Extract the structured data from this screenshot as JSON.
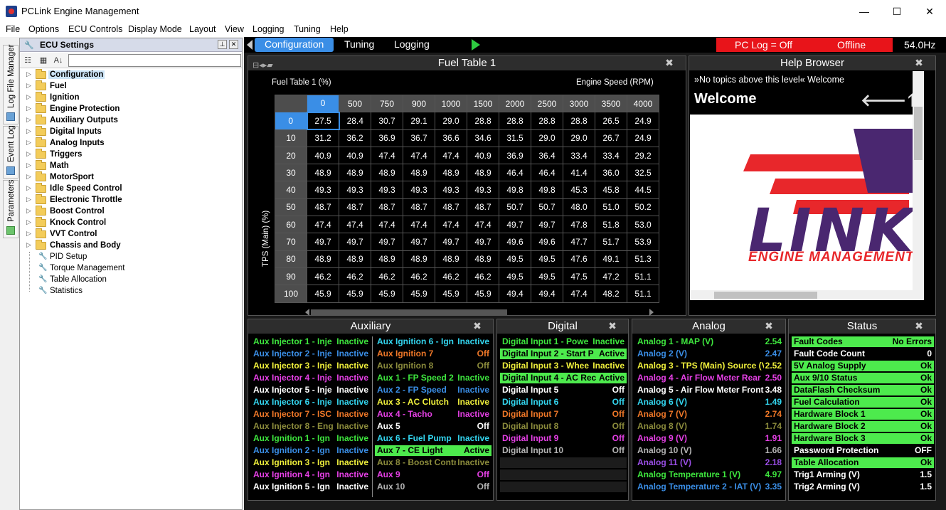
{
  "window": {
    "title": "PCLink Engine Management",
    "minimize": "—",
    "maximize": "☐",
    "close": "✕"
  },
  "menu": [
    "File",
    "Options",
    "ECU Controls",
    "Display Mode",
    "Layout",
    "View",
    "Logging",
    "Tuning",
    "Help"
  ],
  "side_tabs": [
    "Log File Manager",
    "Event Log",
    "Parameters"
  ],
  "ecu": {
    "title": "ECU Settings",
    "folders": [
      "Configuration",
      "Fuel",
      "Ignition",
      "Engine Protection",
      "Auxiliary Outputs",
      "Digital Inputs",
      "Analog Inputs",
      "Triggers",
      "Math",
      "MotorSport",
      "Idle Speed Control",
      "Electronic Throttle",
      "Boost Control",
      "Knock Control",
      "VVT Control",
      "Chassis and Body"
    ],
    "items": [
      "PID Setup",
      "Torque Management",
      "Table Allocation",
      "Statistics"
    ]
  },
  "topbar": {
    "tabs": [
      "Configuration",
      "Tuning",
      "Logging"
    ],
    "pc_log": "PC Log = Off",
    "status": "Offline",
    "rate": "54.0Hz"
  },
  "fuel_table": {
    "title": "Fuel Table 1",
    "table_label": "Fuel Table 1 (%)",
    "x_label": "Engine Speed (RPM)",
    "y_label": "TPS (Main) (%)",
    "rpm": [
      "0",
      "500",
      "750",
      "900",
      "1000",
      "1500",
      "2000",
      "2500",
      "3000",
      "3500",
      "4000"
    ],
    "tps": [
      "0",
      "10",
      "20",
      "30",
      "40",
      "50",
      "60",
      "70",
      "80",
      "90",
      "100"
    ],
    "rows": [
      [
        "27.5",
        "28.4",
        "30.7",
        "29.1",
        "29.0",
        "28.8",
        "28.8",
        "28.8",
        "28.8",
        "26.5",
        "24.9"
      ],
      [
        "31.2",
        "36.2",
        "36.9",
        "36.7",
        "36.6",
        "34.6",
        "31.5",
        "29.0",
        "29.0",
        "26.7",
        "24.9"
      ],
      [
        "40.9",
        "40.9",
        "47.4",
        "47.4",
        "47.4",
        "40.9",
        "36.9",
        "36.4",
        "33.4",
        "33.4",
        "29.2"
      ],
      [
        "48.9",
        "48.9",
        "48.9",
        "48.9",
        "48.9",
        "48.9",
        "46.4",
        "46.4",
        "41.4",
        "36.0",
        "32.5"
      ],
      [
        "49.3",
        "49.3",
        "49.3",
        "49.3",
        "49.3",
        "49.3",
        "49.8",
        "49.8",
        "45.3",
        "45.8",
        "44.5"
      ],
      [
        "48.7",
        "48.7",
        "48.7",
        "48.7",
        "48.7",
        "48.7",
        "50.7",
        "50.7",
        "48.0",
        "51.0",
        "50.2"
      ],
      [
        "47.4",
        "47.4",
        "47.4",
        "47.4",
        "47.4",
        "47.4",
        "49.7",
        "49.7",
        "47.8",
        "51.8",
        "53.0"
      ],
      [
        "49.7",
        "49.7",
        "49.7",
        "49.7",
        "49.7",
        "49.7",
        "49.6",
        "49.6",
        "47.7",
        "51.7",
        "53.9"
      ],
      [
        "48.9",
        "48.9",
        "48.9",
        "48.9",
        "48.9",
        "48.9",
        "49.5",
        "49.5",
        "47.6",
        "49.1",
        "51.3"
      ],
      [
        "46.2",
        "46.2",
        "46.2",
        "46.2",
        "46.2",
        "46.2",
        "49.5",
        "49.5",
        "47.5",
        "47.2",
        "51.1"
      ],
      [
        "45.9",
        "45.9",
        "45.9",
        "45.9",
        "45.9",
        "45.9",
        "49.4",
        "49.4",
        "47.4",
        "48.2",
        "51.1"
      ]
    ]
  },
  "help": {
    "title": "Help Browser",
    "breadcrumb": "»No topics above this level«  Welcome",
    "heading": "Welcome",
    "nav_arrows": "🡐🡑🡒",
    "logo_text": "LINK",
    "logo_sub": "ENGINE MANAGEMENT"
  },
  "auxiliary": {
    "title": "Auxiliary",
    "left": [
      {
        "name": "Aux Injector 1 - Inje",
        "value": "Inactive",
        "color": "#3ee63e"
      },
      {
        "name": "Aux Injector 2 - Inje",
        "value": "Inactive",
        "color": "#3a8ee6"
      },
      {
        "name": "Aux Injector 3 - Inje",
        "value": "Inactive",
        "color": "#f0f03c"
      },
      {
        "name": "Aux Injector 4 - Inje",
        "value": "Inactive",
        "color": "#e640e6"
      },
      {
        "name": "Aux Injector 5 - Inje",
        "value": "Inactive",
        "color": "#ffffff"
      },
      {
        "name": "Aux Injector 6 - Inje",
        "value": "Inactive",
        "color": "#33d6f0"
      },
      {
        "name": "Aux Injector 7 - ISC",
        "value": "Inactive",
        "color": "#f07828"
      },
      {
        "name": "Aux Injector 8 - Eng",
        "value": "Inactive",
        "color": "#8c8c3c"
      },
      {
        "name": "Aux Ignition 1 - Ign",
        "value": "Inactive",
        "color": "#3ee63e"
      },
      {
        "name": "Aux Ignition 2 - Ign",
        "value": "Inactive",
        "color": "#3a8ee6"
      },
      {
        "name": "Aux Ignition 3 - Ign",
        "value": "Inactive",
        "color": "#f0f03c"
      },
      {
        "name": "Aux Ignition 4 - Ign",
        "value": "Inactive",
        "color": "#e640e6"
      },
      {
        "name": "Aux Ignition 5 - Ign",
        "value": "Inactive",
        "color": "#ffffff"
      }
    ],
    "right": [
      {
        "name": "Aux Ignition 6 - Ign",
        "value": "Inactive",
        "color": "#33d6f0",
        "hl": false
      },
      {
        "name": "Aux Ignition 7",
        "value": "Off",
        "color": "#f07828",
        "hl": false
      },
      {
        "name": "Aux Ignition 8",
        "value": "Off",
        "color": "#8c8c3c",
        "hl": false
      },
      {
        "name": "Aux 1 - FP Speed 2",
        "value": "Inactive",
        "color": "#3ee63e",
        "hl": false
      },
      {
        "name": "Aux 2 - FP Speed",
        "value": "Inactive",
        "color": "#3a8ee6",
        "hl": false
      },
      {
        "name": "Aux 3 - AC Clutch",
        "value": "Inactive",
        "color": "#f0f03c",
        "hl": false
      },
      {
        "name": "Aux 4 - Tacho",
        "value": "Inactive",
        "color": "#e640e6",
        "hl": false
      },
      {
        "name": "Aux 5",
        "value": "Off",
        "color": "#ffffff",
        "hl": false
      },
      {
        "name": "Aux 6 - Fuel Pump",
        "value": "Inactive",
        "color": "#33d6f0",
        "hl": false
      },
      {
        "name": "Aux 7 - CE Light",
        "value": "Active",
        "color": "#000000",
        "hl": true
      },
      {
        "name": "Aux 8 - Boost Contr",
        "value": "Inactive",
        "color": "#8c8c3c",
        "hl": false
      },
      {
        "name": "Aux 9",
        "value": "Off",
        "color": "#e640e6",
        "hl": false
      },
      {
        "name": "Aux 10",
        "value": "Off",
        "color": "#b4b4b4",
        "hl": false
      }
    ]
  },
  "digital": {
    "title": "Digital",
    "rows": [
      {
        "name": "Digital Input 1 - Powe",
        "value": "Inactive",
        "color": "#3ee63e",
        "hl": false
      },
      {
        "name": "Digital Input 2 - Start P",
        "value": "Active",
        "color": "#000000",
        "hl": true
      },
      {
        "name": "Digital Input 3 - Whee",
        "value": "Inactive",
        "color": "#f0f03c",
        "hl": false
      },
      {
        "name": "Digital Input 4 - AC Rec",
        "value": "Active",
        "color": "#000000",
        "hl": true
      },
      {
        "name": "Digital Input 5",
        "value": "Off",
        "color": "#ffffff",
        "hl": false
      },
      {
        "name": "Digital Input 6",
        "value": "Off",
        "color": "#33d6f0",
        "hl": false
      },
      {
        "name": "Digital Input 7",
        "value": "Off",
        "color": "#f07828",
        "hl": false
      },
      {
        "name": "Digital Input 8",
        "value": "Off",
        "color": "#8c8c3c",
        "hl": false
      },
      {
        "name": "Digital Input 9",
        "value": "Off",
        "color": "#e640e6",
        "hl": false
      },
      {
        "name": "Digital Input 10",
        "value": "Off",
        "color": "#b4b4b4",
        "hl": false
      }
    ]
  },
  "analog": {
    "title": "Analog",
    "rows": [
      {
        "name": "Analog 1 - MAP (V)",
        "value": "2.54",
        "color": "#3ee63e"
      },
      {
        "name": "Analog 2 (V)",
        "value": "2.47",
        "color": "#3a8ee6"
      },
      {
        "name": "Analog 3 - TPS (Main) Source (V",
        "value": "2.52",
        "color": "#f0f03c"
      },
      {
        "name": "Analog 4 - Air Flow Meter Rear",
        "value": "2.50",
        "color": "#e640e6"
      },
      {
        "name": "Analog 5 - Air Flow Meter Front",
        "value": "3.48",
        "color": "#ffffff"
      },
      {
        "name": "Analog 6 (V)",
        "value": "1.49",
        "color": "#33d6f0"
      },
      {
        "name": "Analog 7 (V)",
        "value": "2.74",
        "color": "#f07828"
      },
      {
        "name": "Analog 8 (V)",
        "value": "1.74",
        "color": "#8c8c3c"
      },
      {
        "name": "Analog 9 (V)",
        "value": "1.91",
        "color": "#e640e6"
      },
      {
        "name": "Analog 10 (V)",
        "value": "1.66",
        "color": "#b4b4b4"
      },
      {
        "name": "Analog 11 (V)",
        "value": "2.18",
        "color": "#9a4ee6"
      },
      {
        "name": "Analog Temperature 1 (V)",
        "value": "4.97",
        "color": "#3ee63e"
      },
      {
        "name": "Analog Temperature 2 - IAT (V)",
        "value": "3.35",
        "color": "#3a8ee6"
      }
    ]
  },
  "status": {
    "title": "Status",
    "rows": [
      {
        "name": "Fault Codes",
        "value": "No Errors",
        "hl": true
      },
      {
        "name": "Fault Code Count",
        "value": "0",
        "hl": false
      },
      {
        "name": "5V Analog Supply",
        "value": "Ok",
        "hl": true
      },
      {
        "name": "Aux 9/10 Status",
        "value": "Ok",
        "hl": true
      },
      {
        "name": "DataFlash Checksum",
        "value": "Ok",
        "hl": true
      },
      {
        "name": "Fuel Calculation",
        "value": "Ok",
        "hl": true
      },
      {
        "name": "Hardware Block 1",
        "value": "Ok",
        "hl": true
      },
      {
        "name": "Hardware Block 2",
        "value": "Ok",
        "hl": true
      },
      {
        "name": "Hardware Block 3",
        "value": "Ok",
        "hl": true
      },
      {
        "name": "Password Protection",
        "value": "OFF",
        "hl": false
      },
      {
        "name": "Table Allocation",
        "value": "Ok",
        "hl": true
      },
      {
        "name": "Trig1 Arming (V)",
        "value": "1.5",
        "hl": false
      },
      {
        "name": "Trig2 Arming (V)",
        "value": "1.5",
        "hl": false
      }
    ]
  },
  "colors": {
    "accent": "#3a8ee6",
    "ok_green": "#4dea4d",
    "pclog_red": "#e8141a"
  }
}
